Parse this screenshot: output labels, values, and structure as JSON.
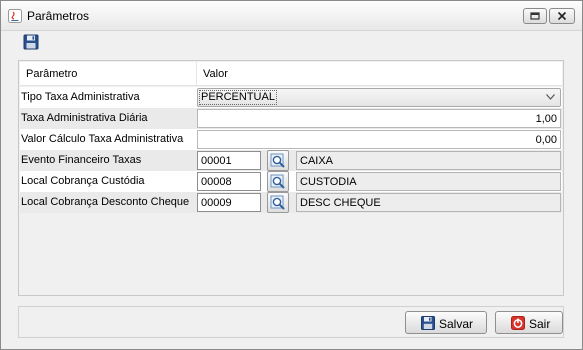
{
  "window": {
    "title": "Parâmetros"
  },
  "toolbar": {
    "save_icon": "floppy-disk-icon"
  },
  "table": {
    "headers": [
      "Parâmetro",
      "Valor"
    ],
    "rows": [
      {
        "label": "Tipo Taxa Administrativa",
        "value": "PERCENTUAL"
      },
      {
        "label": "Taxa Administrativa Diária",
        "value": "1,00"
      },
      {
        "label": "Valor Cálculo Taxa Administrativa",
        "value": "0,00"
      },
      {
        "label": "Evento Financeiro Taxas",
        "code": "00001",
        "description": "CAIXA"
      },
      {
        "label": "Local Cobrança Custódia",
        "code": "00008",
        "description": "CUSTODIA"
      },
      {
        "label": "Local Cobrança Desconto Cheque",
        "code": "00009",
        "description": "DESC CHEQUE"
      }
    ]
  },
  "footer": {
    "save_label": "Salvar",
    "exit_label": "Sair"
  },
  "colors": {
    "window_bg": "#f0f0f0",
    "alt_row": "#eaeaea",
    "exit_icon_red": "#d9342b",
    "floppy_blue": "#2a4f8f"
  }
}
